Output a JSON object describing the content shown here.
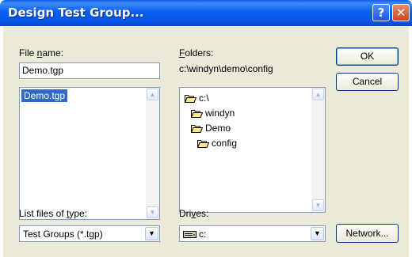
{
  "window": {
    "title": "Design Test Group...",
    "help_glyph": "?",
    "close_glyph": "✕"
  },
  "file_name": {
    "label_pre": "File ",
    "label_key": "n",
    "label_post": "ame:",
    "value": "Demo.tgp",
    "list": [
      "Demo.tgp"
    ],
    "selected": "Demo.tgp"
  },
  "folders": {
    "label_key": "F",
    "label_post": "olders:",
    "path": "c:\\windyn\\demo\\config",
    "tree": [
      {
        "name": "c:\\",
        "depth": 0,
        "open": true
      },
      {
        "name": "windyn",
        "depth": 1,
        "open": true
      },
      {
        "name": "Demo",
        "depth": 2,
        "open": true
      },
      {
        "name": "config",
        "depth": 3,
        "open": true
      }
    ]
  },
  "file_type": {
    "label_pre": "List files of ",
    "label_key": "t",
    "label_post": "ype:",
    "value": "Test Groups (*.tgp)"
  },
  "drives": {
    "label_pre": "Dri",
    "label_key": "v",
    "label_post": "es:",
    "value": "c:"
  },
  "buttons": {
    "ok": "OK",
    "cancel": "Cancel",
    "network": "Network..."
  },
  "dropdown_glyph": "▼",
  "scroll_up_glyph": "▲",
  "scroll_down_glyph": "▼"
}
